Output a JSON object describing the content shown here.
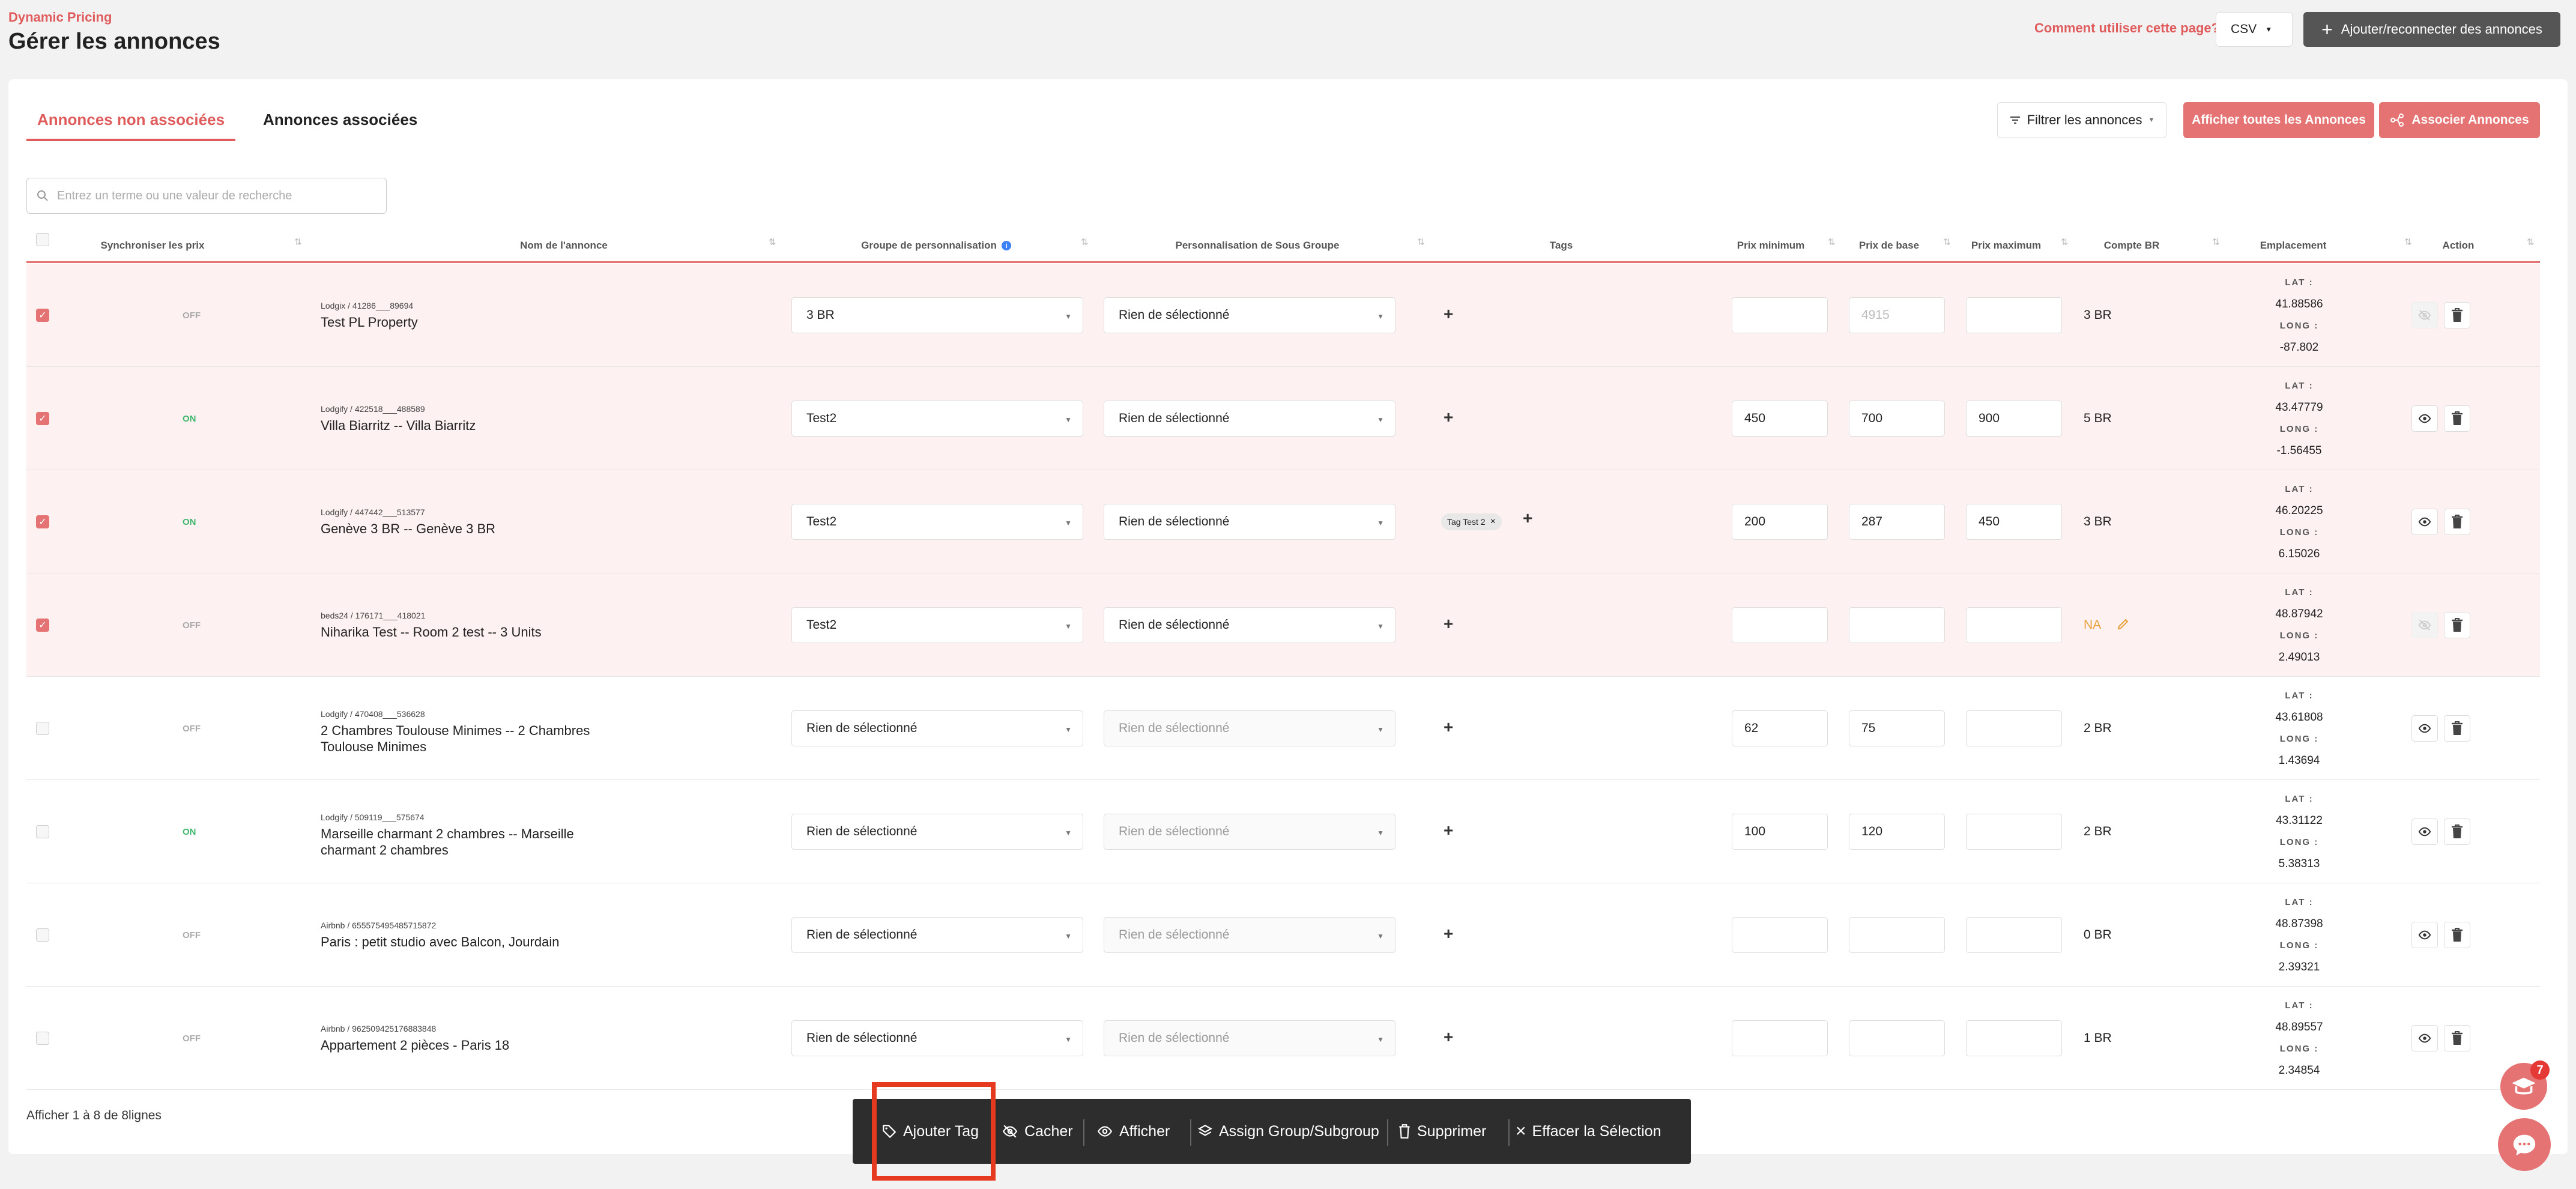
{
  "header": {
    "eyebrow": "Dynamic Pricing",
    "title": "Gérer les annonces",
    "help_link": "Comment utiliser cette page?",
    "export_format": "CSV",
    "add_listings_button": "Ajouter/reconnecter des annonces"
  },
  "tabs": [
    {
      "label": "Annonces non associées",
      "active": true
    },
    {
      "label": "Annonces associées",
      "active": false
    }
  ],
  "toolbar": {
    "filter_button": "Filtrer les annonces",
    "show_all_button": "Afficher toutes les Annonces",
    "associate_button": "Associer Annonces"
  },
  "search": {
    "placeholder": "Entrez un terme ou une valeur de recherche",
    "value": ""
  },
  "table": {
    "columns": {
      "sync": "Synchroniser les prix",
      "name": "Nom de l'annonce",
      "group": "Groupe de personnalisation",
      "subgroup": "Personnalisation de Sous Groupe",
      "tags": "Tags",
      "min": "Prix minimum",
      "base": "Prix de base",
      "max": "Prix maximum",
      "br": "Compte BR",
      "location": "Emplacement",
      "action": "Action"
    },
    "lat_label": "LAT :",
    "long_label": "LONG :",
    "rows": [
      {
        "checked": true,
        "sync": "OFF",
        "source": "Lodgix / 41286___89694",
        "name": "Test PL Property",
        "group": "3 BR",
        "subgroup": "Rien de sélectionné",
        "subgroup_disabled": false,
        "tags": [],
        "min": "",
        "base": "4915",
        "base_placeholder": true,
        "max": "",
        "br": "3 BR",
        "lat": "41.88586",
        "long": "-87.802",
        "hidden": true
      },
      {
        "checked": true,
        "sync": "ON",
        "source": "Lodgify / 422518___488589",
        "name": "Villa Biarritz -- Villa Biarritz",
        "group": "Test2",
        "subgroup": "Rien de sélectionné",
        "subgroup_disabled": false,
        "tags": [],
        "min": "450",
        "base": "700",
        "base_placeholder": false,
        "max": "900",
        "br": "5 BR",
        "lat": "43.47779",
        "long": "-1.56455",
        "hidden": false
      },
      {
        "checked": true,
        "sync": "ON",
        "source": "Lodgify / 447442___513577",
        "name": "Genève 3 BR -- Genève 3 BR",
        "group": "Test2",
        "subgroup": "Rien de sélectionné",
        "subgroup_disabled": false,
        "tags": [
          "Tag Test 2"
        ],
        "min": "200",
        "base": "287",
        "base_placeholder": false,
        "max": "450",
        "br": "3 BR",
        "lat": "46.20225",
        "long": "6.15026",
        "hidden": false
      },
      {
        "checked": true,
        "sync": "OFF",
        "source": "beds24 / 176171___418021",
        "name": "Niharika Test -- Room 2 test -- 3 Units",
        "group": "Test2",
        "subgroup": "Rien de sélectionné",
        "subgroup_disabled": false,
        "tags": [],
        "min": "",
        "base": "",
        "base_placeholder": false,
        "max": "",
        "br": "NA",
        "br_na": true,
        "lat": "48.87942",
        "long": "2.49013",
        "hidden": true
      },
      {
        "checked": false,
        "sync": "OFF",
        "source": "Lodgify / 470408___536628",
        "name": "2 Chambres Toulouse Minimes -- 2 Chambres Toulouse Minimes",
        "group": "Rien de sélectionné",
        "subgroup": "Rien de sélectionné",
        "subgroup_disabled": true,
        "tags": [],
        "min": "62",
        "base": "75",
        "base_placeholder": false,
        "max": "",
        "br": "2 BR",
        "lat": "43.61808",
        "long": "1.43694",
        "hidden": false
      },
      {
        "checked": false,
        "sync": "ON",
        "source": "Lodgify / 509119___575674",
        "name": "Marseille charmant 2 chambres -- Marseille charmant 2 chambres",
        "group": "Rien de sélectionné",
        "subgroup": "Rien de sélectionné",
        "subgroup_disabled": true,
        "tags": [],
        "min": "100",
        "base": "120",
        "base_placeholder": false,
        "max": "",
        "br": "2 BR",
        "lat": "43.31122",
        "long": "5.38313",
        "hidden": false
      },
      {
        "checked": false,
        "sync": "OFF",
        "source": "Airbnb / 655575495485715872",
        "name": "Paris : petit studio avec Balcon, Jourdain",
        "group": "Rien de sélectionné",
        "subgroup": "Rien de sélectionné",
        "subgroup_disabled": true,
        "tags": [],
        "min": "",
        "base": "",
        "base_placeholder": false,
        "max": "",
        "br": "0 BR",
        "lat": "48.87398",
        "long": "2.39321",
        "hidden": false
      },
      {
        "checked": false,
        "sync": "OFF",
        "source": "Airbnb / 962509425176883848",
        "name": "Appartement 2 pièces - Paris 18",
        "group": "Rien de sélectionné",
        "subgroup": "Rien de sélectionné",
        "subgroup_disabled": true,
        "tags": [],
        "min": "",
        "base": "",
        "base_placeholder": false,
        "max": "",
        "br": "1 BR",
        "lat": "48.89557",
        "long": "2.34854",
        "hidden": false
      }
    ]
  },
  "pagination": {
    "info": "Afficher 1 à 8 de 8lignes"
  },
  "bulk_actions": {
    "add_tag": "Ajouter Tag",
    "hide": "Cacher",
    "show": "Afficher",
    "assign": "Assign Group/Subgroup",
    "delete": "Supprimer",
    "clear": "Effacer la Sélection"
  },
  "notifications": {
    "count": "7"
  },
  "colors": {
    "accent": "#e57373",
    "on": "#3db66b",
    "off": "#aaaaaa",
    "na": "#e8a13a",
    "highlight": "#e53a20"
  }
}
